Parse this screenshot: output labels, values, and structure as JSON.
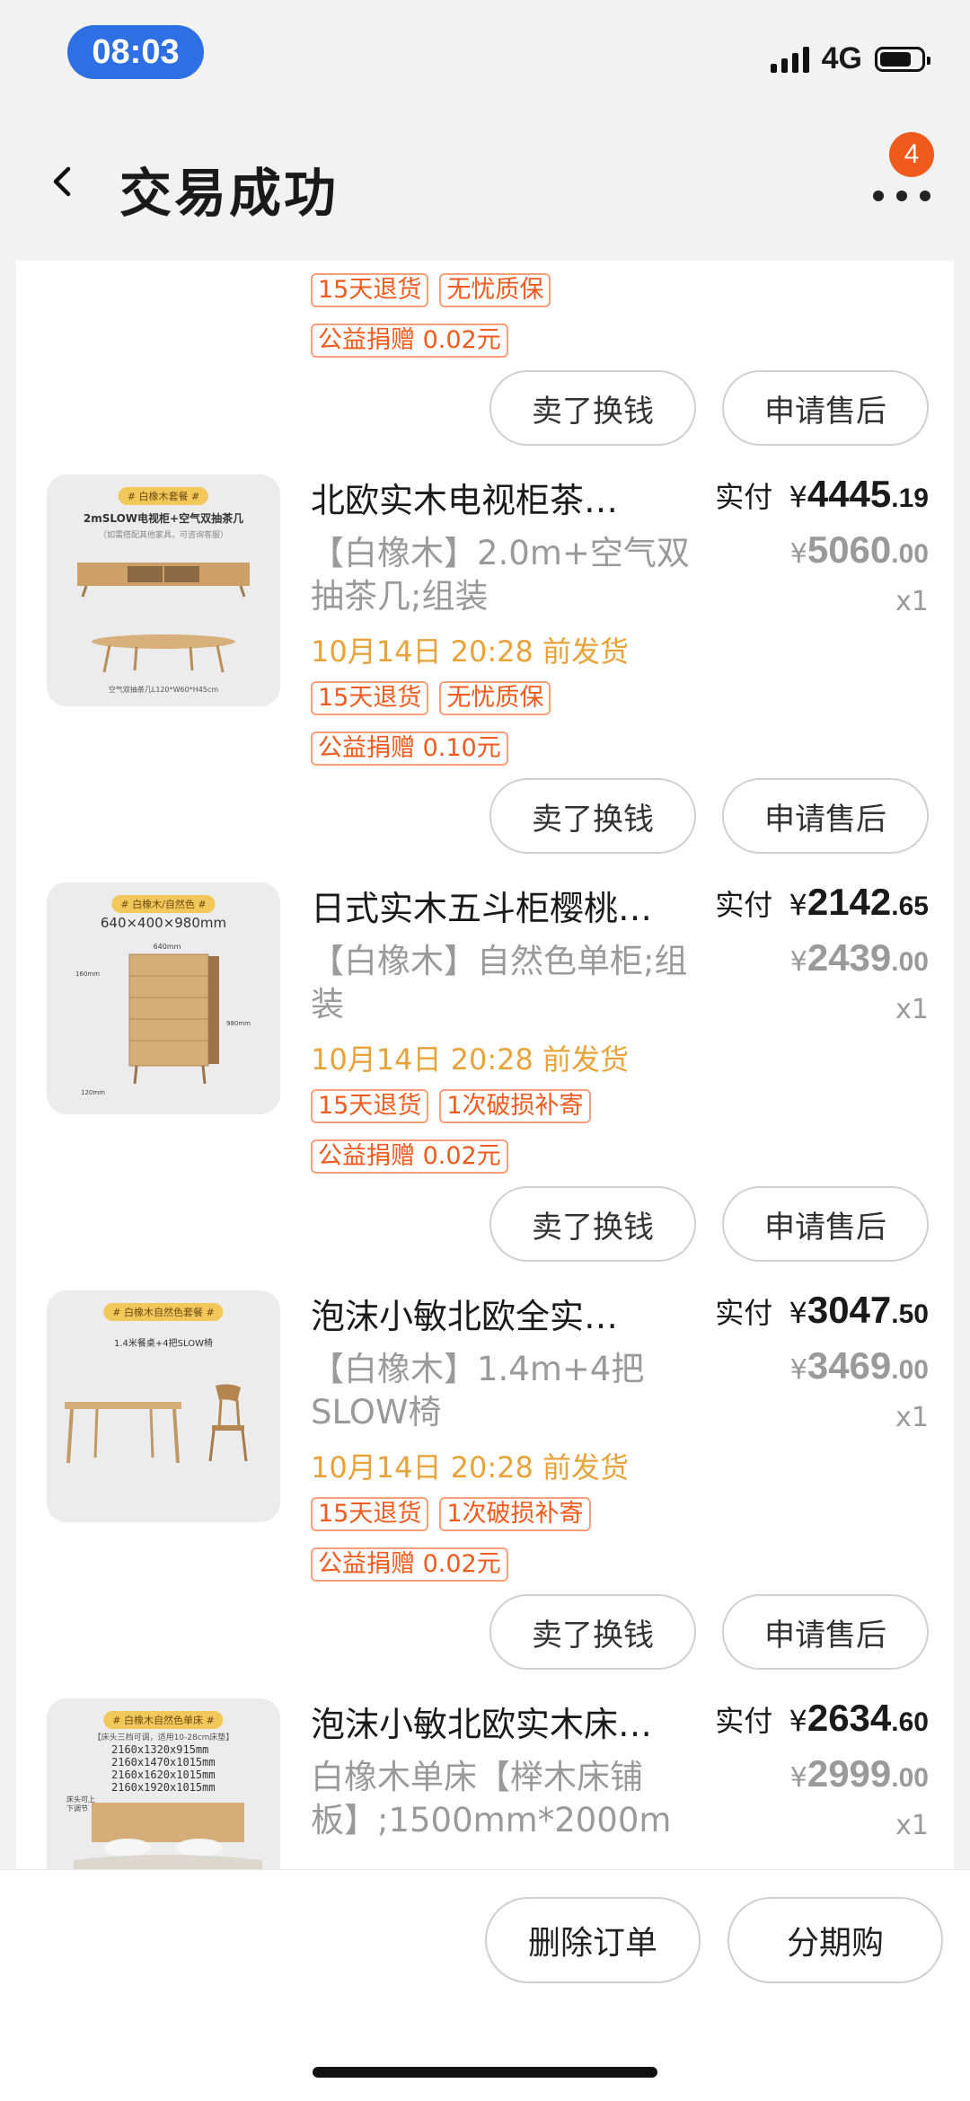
{
  "status": {
    "time": "08:03",
    "network": "4G"
  },
  "nav": {
    "title": "交易成功",
    "badge": "4"
  },
  "top_item": {
    "tags": [
      "15天退货",
      "无忧质保"
    ],
    "donation": "公益捐赠 0.02元",
    "sell_label": "卖了换钱",
    "aftersale_label": "申请售后"
  },
  "items": [
    {
      "title": "北欧实木电视柜茶…",
      "spec": "【白橡木】2.0m+空气双抽茶几;组装",
      "ship": "10月14日 20:28 前发货",
      "tags": [
        "15天退货",
        "无忧质保"
      ],
      "donation": "公益捐赠 0.10元",
      "paid_label": "实付",
      "paid_currency": "¥",
      "paid_int": "4445",
      "paid_dec": ".19",
      "orig_currency": "¥",
      "orig_int": "5060",
      "orig_dec": ".00",
      "qty": "x1",
      "sell_label": "卖了换钱",
      "aftersale_label": "申请售后",
      "thumb": {
        "chip": "# 白橡木套餐 #",
        "caption": "2mSLOW电视柜+空气双抽茶几",
        "sub": "（如需搭配其他家具，可咨询客服）",
        "foot": "空气双抽茶几L120*W60*H45cm"
      }
    },
    {
      "title": "日式实木五斗柜樱桃…",
      "spec": "【白橡木】自然色单柜;组装",
      "ship": "10月14日 20:28 前发货",
      "tags": [
        "15天退货",
        "1次破损补寄"
      ],
      "donation": "公益捐赠 0.02元",
      "paid_label": "实付",
      "paid_currency": "¥",
      "paid_int": "2142",
      "paid_dec": ".65",
      "orig_currency": "¥",
      "orig_int": "2439",
      "orig_dec": ".00",
      "qty": "x1",
      "sell_label": "卖了换钱",
      "aftersale_label": "申请售后",
      "thumb": {
        "chip": "# 白橡木/自然色 #",
        "caption": "640×400×980mm",
        "w": "640mm",
        "h1": "160mm",
        "h2": "980mm",
        "h3": "120mm"
      }
    },
    {
      "title": "泡沫小敏北欧全实…",
      "spec": "【白橡木】1.4m+4把SLOW椅",
      "ship": "10月14日 20:28 前发货",
      "tags": [
        "15天退货",
        "1次破损补寄"
      ],
      "donation": "公益捐赠 0.02元",
      "paid_label": "实付",
      "paid_currency": "¥",
      "paid_int": "3047",
      "paid_dec": ".50",
      "orig_currency": "¥",
      "orig_int": "3469",
      "orig_dec": ".00",
      "qty": "x1",
      "sell_label": "卖了换钱",
      "aftersale_label": "申请售后",
      "thumb": {
        "chip": "# 白橡木自然色套餐 #",
        "caption": "1.4米餐桌+4把SLOW椅"
      }
    },
    {
      "title": "泡沫小敏北欧实木床…",
      "spec": "白橡木单床【榉木床铺板】;1500mm*2000m",
      "paid_label": "实付",
      "paid_currency": "¥",
      "paid_int": "2634",
      "paid_dec": ".60",
      "orig_currency": "¥",
      "orig_int": "2999",
      "orig_dec": ".00",
      "qty": "x1",
      "thumb": {
        "chip": "# 白橡木自然色单床 #",
        "caption": "【床头三档可调，适用10-28cm床垫】",
        "sizes": [
          "2160x1320x915mm",
          "2160x1470x1015mm",
          "2160x1620x1015mm",
          "2160x1920x1015mm"
        ],
        "side": "床头可上下调节"
      }
    }
  ],
  "bottom": {
    "delete_label": "删除订单",
    "installment_label": "分期购"
  }
}
